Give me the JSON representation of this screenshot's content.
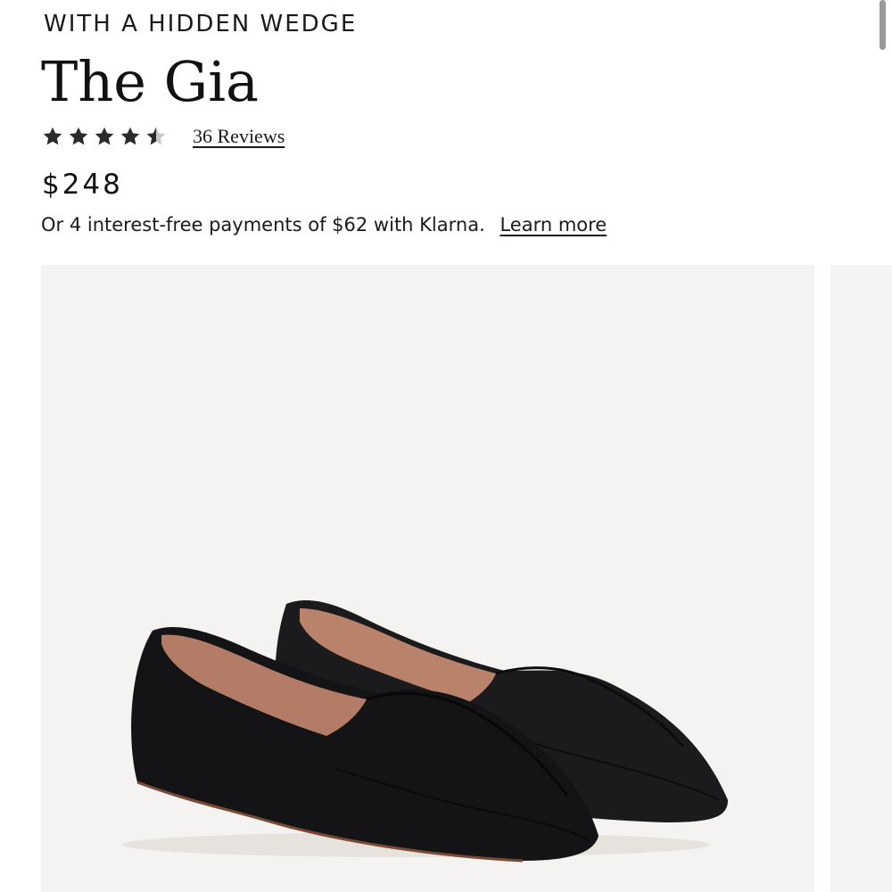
{
  "product": {
    "eyebrow": "WITH A HIDDEN WEDGE",
    "name": "The Gia",
    "rating": 4.5,
    "rating_max": 5,
    "reviews_link": "36 Reviews",
    "price": "$248",
    "installment_text": "Or 4 interest-free payments of $62 with Klarna.",
    "learn_more_link": "Learn more"
  },
  "gallery": {
    "main_image_icon": "black-leather-loafer-pair-photo",
    "next_image_icon": "product-photo-preview"
  },
  "colors": {
    "text": "#1a1a1a",
    "star": "#2b2b2b",
    "star_empty": "#c8c8c8",
    "image_bg": "#f5f3f1"
  }
}
